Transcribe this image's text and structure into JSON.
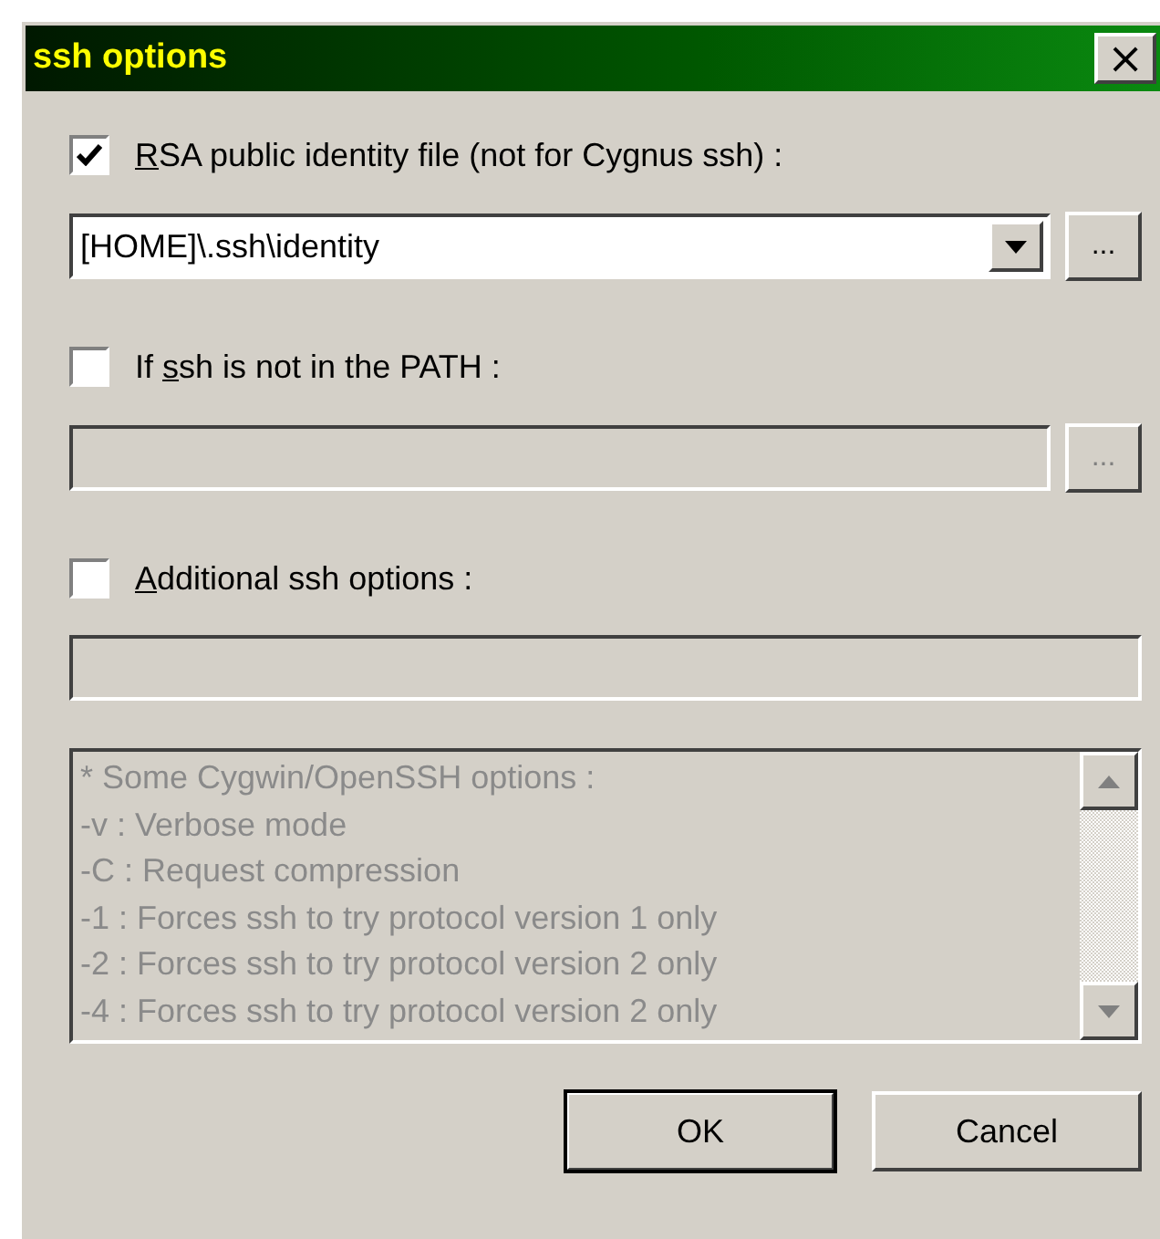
{
  "window": {
    "title": "ssh options",
    "close": "×"
  },
  "sections": [
    {
      "checkbox": {
        "checked": true,
        "label_parts": {
          "key": "R",
          "after": "SA public identity file (not for Cygnus ssh) :"
        }
      },
      "field": {
        "kind": "combo",
        "value": "[HOME]\\.ssh\\identity",
        "disabled": false,
        "browse": "..."
      }
    },
    {
      "checkbox": {
        "checked": false,
        "label_parts": {
          "before": "If ",
          "key": "s",
          "after": "sh is not in the PATH :"
        }
      },
      "field": {
        "kind": "text",
        "disabled": true,
        "browse": "..."
      }
    },
    {
      "checkbox": {
        "checked": false,
        "label_parts": {
          "key": "A",
          "after": "dditional ssh options :"
        }
      },
      "field": {
        "kind": "text",
        "disabled": true
      }
    }
  ],
  "memo": {
    "disabled": true,
    "lines": [
      "* Some Cygwin/OpenSSH options :",
      "-v : Verbose mode",
      "-C : Request compression",
      "-1 : Forces ssh to try protocol version 1 only",
      "-2 : Forces ssh to try protocol version 2 only",
      "-4 : Forces ssh to try protocol version 2 only"
    ]
  },
  "buttons": [
    {
      "label": "OK",
      "default": true
    },
    {
      "label": "Cancel",
      "default": false
    }
  ]
}
